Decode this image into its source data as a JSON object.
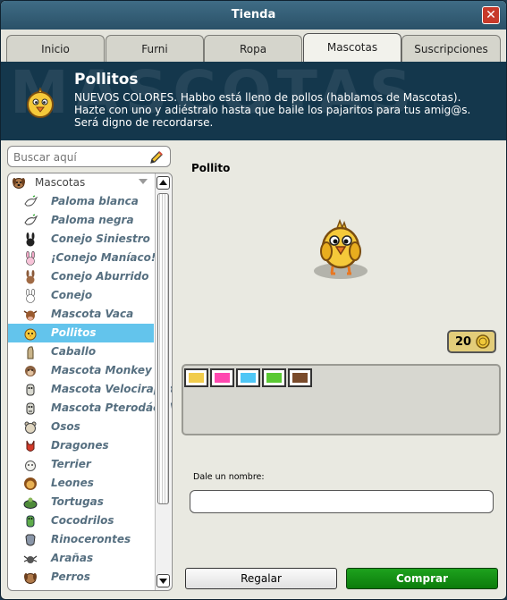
{
  "window": {
    "title": "Tienda",
    "close_glyph": "✕"
  },
  "tabs": [
    {
      "label": "Inicio"
    },
    {
      "label": "Furni"
    },
    {
      "label": "Ropa"
    },
    {
      "label": "Mascotas",
      "active": true
    },
    {
      "label": "Suscripciones"
    }
  ],
  "banner": {
    "watermark": "MASCOTAS",
    "title": "Pollitos",
    "description": "NUEVOS COLORES. Habbo está lleno de pollos (hablamos de Mascotas). Hazte con uno y adiéstralo hasta que baile los pajaritos para tus amig@s. Será digno de recordarse.",
    "icon": "chick-icon"
  },
  "search": {
    "placeholder": "Buscar aquí",
    "icon": "pencil-icon"
  },
  "tree": {
    "category": "Mascotas",
    "category_icon": "dog-icon",
    "items": [
      {
        "label": "Paloma blanca",
        "icon": "white-dove-icon"
      },
      {
        "label": "Paloma negra",
        "icon": "black-dove-icon"
      },
      {
        "label": "Conejo Siniestro",
        "icon": "black-rabbit-icon"
      },
      {
        "label": "¡Conejo Maníaco!",
        "icon": "pink-rabbit-icon"
      },
      {
        "label": "Conejo Aburrido",
        "icon": "brown-rabbit-icon"
      },
      {
        "label": "Conejo",
        "icon": "white-rabbit-icon"
      },
      {
        "label": "Mascota Vaca",
        "icon": "cow-icon"
      },
      {
        "label": "Pollitos",
        "icon": "chick-icon",
        "selected": true
      },
      {
        "label": "Caballo",
        "icon": "horse-icon"
      },
      {
        "label": "Mascota Monkey",
        "icon": "monkey-icon"
      },
      {
        "label": "Mascota Velociraptor",
        "icon": "velociraptor-icon"
      },
      {
        "label": "Mascota Pterodáctilo",
        "icon": "pterodactyl-icon"
      },
      {
        "label": "Osos",
        "icon": "bear-icon"
      },
      {
        "label": "Dragones",
        "icon": "dragon-icon"
      },
      {
        "label": "Terrier",
        "icon": "terrier-icon"
      },
      {
        "label": "Leones",
        "icon": "lion-icon"
      },
      {
        "label": "Tortugas",
        "icon": "turtle-icon"
      },
      {
        "label": "Cocodrilos",
        "icon": "crocodile-icon"
      },
      {
        "label": "Rinocerontes",
        "icon": "rhino-icon"
      },
      {
        "label": "Arañas",
        "icon": "spider-icon"
      },
      {
        "label": "Perros",
        "icon": "dog-icon"
      }
    ]
  },
  "product": {
    "name": "Pollito",
    "price": "20",
    "price_icon": "credits-coin-icon",
    "colors": [
      "#f1cc4c",
      "#ff48b0",
      "#4fc7f6",
      "#5ac933",
      "#7a4b2b"
    ]
  },
  "name_field": {
    "label": "Dale un nombre:",
    "value": ""
  },
  "actions": {
    "gift": "Regalar",
    "buy": "Comprar"
  }
}
